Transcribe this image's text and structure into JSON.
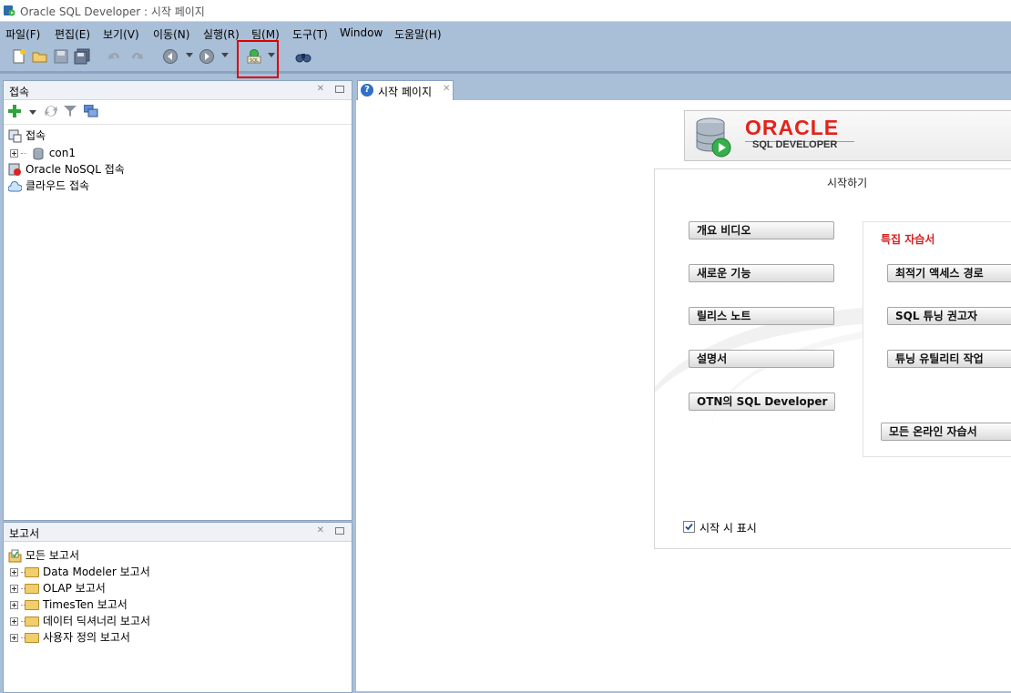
{
  "window": {
    "title": "Oracle SQL Developer : 시작 페이지"
  },
  "menu": [
    "파일(F)",
    "편집(E)",
    "보기(V)",
    "이동(N)",
    "실행(R)",
    "팀(M)",
    "도구(T)",
    "Window",
    "도움말(H)"
  ],
  "toolbar": {
    "icons": [
      "new-icon",
      "open-icon",
      "save-icon",
      "save-all-icon",
      "undo-icon",
      "redo-icon",
      "back-icon",
      "forward-icon",
      "sql-worksheet-icon",
      "find-icon"
    ],
    "highlight_color": "#e00000"
  },
  "connections_panel": {
    "title": "접속",
    "tree": [
      {
        "label": "접속",
        "icon": "connections-icon"
      },
      {
        "label": "con1",
        "icon": "database-icon"
      },
      {
        "label": "Oracle NoSQL 접속",
        "icon": "nosql-icon"
      },
      {
        "label": "클라우드 접속",
        "icon": "cloud-icon"
      }
    ]
  },
  "reports_panel": {
    "title": "보고서",
    "tree": [
      {
        "label": "모든 보고서"
      },
      {
        "label": "Data Modeler 보고서"
      },
      {
        "label": "OLAP 보고서"
      },
      {
        "label": "TimesTen 보고서"
      },
      {
        "label": "데이터 딕셔너리 보고서"
      },
      {
        "label": "사용자 정의 보고서"
      }
    ]
  },
  "tab": {
    "label": "시작 페이지"
  },
  "start_page": {
    "logo_word": "ORACLE",
    "logo_sub": "SQL DEVELOPER",
    "heading": "시작하기",
    "left_buttons": [
      "개요 비디오",
      "새로운 기능",
      "릴리스 노트",
      "설명서",
      "OTN의 SQL Developer"
    ],
    "tutorial_heading": "특집 자습서",
    "tutorial_buttons": [
      "최적기 액세스 경로",
      "SQL 튜닝 권고자",
      "튜닝 유틸리티 작업"
    ],
    "all_tutorials": "모든 온라인 자습서",
    "show_on_startup": "시작 시 표시",
    "show_on_startup_checked": true,
    "colors": {
      "oracle_red": "#e2231a",
      "tutorial_heading": "#d42020"
    }
  }
}
